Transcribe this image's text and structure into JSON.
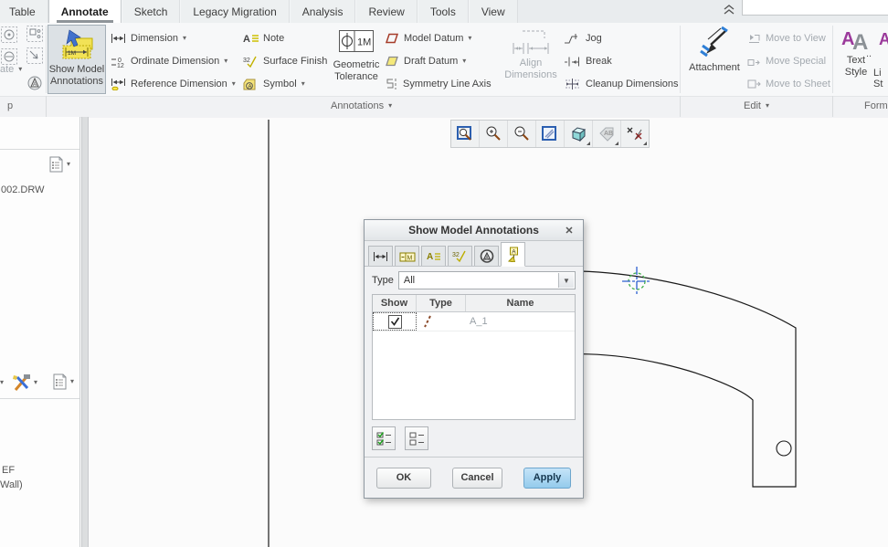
{
  "ribbon_tabs": [
    {
      "label": "Table"
    },
    {
      "label": "Annotate"
    },
    {
      "label": "Sketch"
    },
    {
      "label": "Legacy Migration"
    },
    {
      "label": "Analysis"
    },
    {
      "label": "Review"
    },
    {
      "label": "Tools"
    },
    {
      "label": "View"
    }
  ],
  "ribbon": {
    "partial_group": {
      "create_label": "ate"
    },
    "show_model_annotations": {
      "line1": "Show Model",
      "line2": "Annotations"
    },
    "dimension": "Dimension",
    "ordinate_dimension": "Ordinate Dimension",
    "reference_dimension": "Reference Dimension",
    "note": "Note",
    "surface_finish": "Surface Finish",
    "symbol": "Symbol",
    "geometric_tolerance": {
      "line1": "Geometric",
      "line2": "Tolerance"
    },
    "model_datum": "Model Datum",
    "draft_datum": "Draft Datum",
    "symmetry_line_axis": "Symmetry Line Axis",
    "align_dimensions": {
      "line1": "Align",
      "line2": "Dimensions"
    },
    "jog": "Jog",
    "break": "Break",
    "cleanup_dimensions": "Cleanup Dimensions",
    "attachment": "Attachment",
    "move_to_view": "Move to View",
    "move_special": "Move Special",
    "move_to_sheet": "Move to Sheet",
    "text_style": {
      "line1": "Text",
      "line2": "Style"
    },
    "next_partial": {
      "dots": "..",
      "line1": "Li",
      "line2": "St"
    },
    "group_labels": {
      "left_partial": "p",
      "annotations": "Annotations",
      "edit": "Edit",
      "format_partial": "Forma"
    }
  },
  "left_panel": {
    "file_name": "002.DRW",
    "truncated_text_1": "EF",
    "truncated_text_2": "Wall)"
  },
  "dialog": {
    "title": "Show Model Annotations",
    "type_label": "Type",
    "type_value": "All",
    "table": {
      "col_show": "Show",
      "col_type": "Type",
      "col_name": "Name",
      "rows": [
        {
          "show": true,
          "type_icon": "axis-icon",
          "name": "A_1"
        }
      ]
    },
    "ok": "OK",
    "cancel": "Cancel",
    "apply": "Apply"
  },
  "colors": {
    "apply_accent": "#94cbec",
    "annotation_yellow": "#efe06a",
    "axis_green": "#3fae49",
    "crosshair_blue": "#2d5fd0",
    "datum_red": "#a63c2a"
  }
}
